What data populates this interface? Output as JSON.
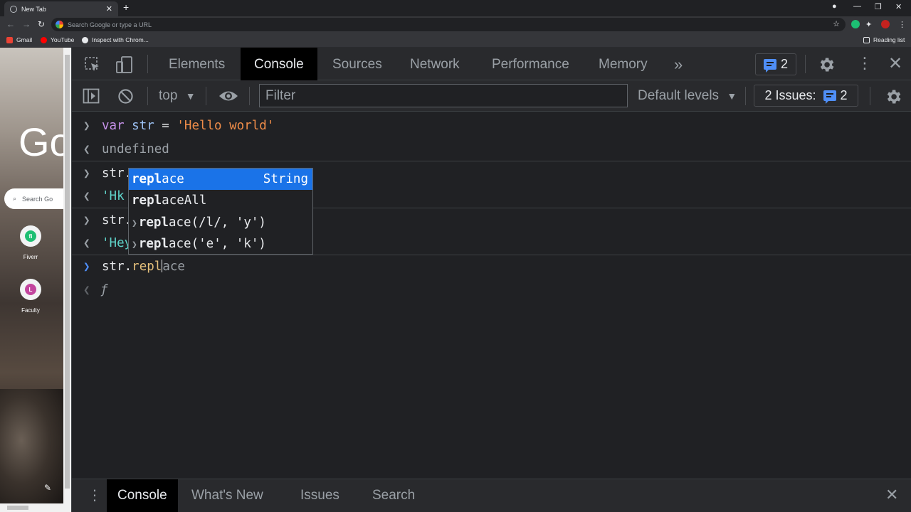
{
  "browser": {
    "tab_title": "New Tab",
    "omnibox_placeholder": "Search Google or type a URL",
    "bookmarks": [
      {
        "label": "Gmail",
        "color": "#ea4335"
      },
      {
        "label": "YouTube",
        "color": "#ff0000"
      },
      {
        "label": "Inspect with Chrom...",
        "color": "#e8eaed"
      }
    ],
    "reading_list": "Reading list"
  },
  "page": {
    "logo_text": "Go",
    "search_placeholder": "Search Go",
    "shortcuts": [
      {
        "label": "Fiverr",
        "initial": "fi",
        "color": "#1dbf73"
      },
      {
        "label": "Faculty",
        "initial": "L",
        "color": "#c2459e"
      }
    ]
  },
  "devtools": {
    "tabs": [
      "Elements",
      "Console",
      "Sources",
      "Network",
      "Performance",
      "Memory"
    ],
    "more_tabs": "»",
    "message_count": "2",
    "context": "top",
    "filter_placeholder": "Filter",
    "levels": "Default levels",
    "issues_label": "2 Issues:",
    "issues_count": "2",
    "console": {
      "l1": {
        "kw": "var",
        "var": "str",
        "op": " = ",
        "str": "'Hello world'"
      },
      "l2": "undefined",
      "l3": "str.",
      "l4": "'Hk",
      "l5": "str.",
      "l6": "'Hey",
      "l7_prefix": "str.",
      "l7_typed": "repl",
      "l7_suggest": "ace",
      "l8": "ƒ"
    },
    "autocomplete": {
      "items": [
        {
          "match": "repl",
          "rest": "ace",
          "type": "String"
        },
        {
          "match": "repl",
          "rest": "aceAll",
          "type": ""
        },
        {
          "match": "repl",
          "rest": "ace(/l/, 'y')",
          "type": ""
        },
        {
          "match": "repl",
          "rest": "ace('e', 'k')",
          "type": ""
        }
      ]
    },
    "drawer_tabs": [
      "Console",
      "What's New",
      "Issues",
      "Search"
    ]
  }
}
